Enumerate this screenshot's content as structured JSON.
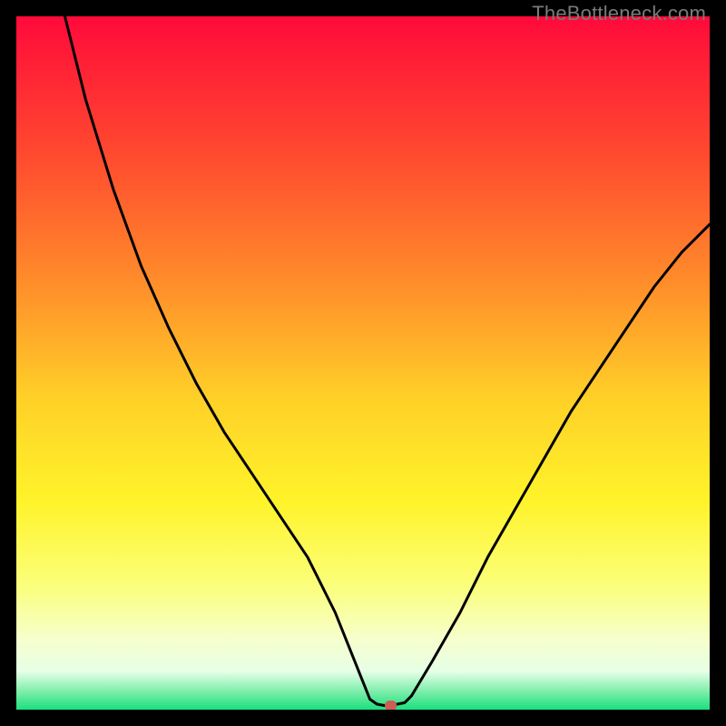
{
  "watermark": "TheBottleneck.com",
  "chart_data": {
    "type": "line",
    "title": "",
    "xlabel": "",
    "ylabel": "",
    "xlim": [
      0,
      100
    ],
    "ylim": [
      0,
      100
    ],
    "background_gradient": {
      "stops": [
        {
          "offset": 0.0,
          "color": "#ff0a3a"
        },
        {
          "offset": 0.2,
          "color": "#ff4a2f"
        },
        {
          "offset": 0.4,
          "color": "#ff932a"
        },
        {
          "offset": 0.55,
          "color": "#ffd028"
        },
        {
          "offset": 0.7,
          "color": "#fff32a"
        },
        {
          "offset": 0.82,
          "color": "#fbff7a"
        },
        {
          "offset": 0.9,
          "color": "#f6ffce"
        },
        {
          "offset": 0.945,
          "color": "#e6ffe6"
        },
        {
          "offset": 0.97,
          "color": "#8bf0b2"
        },
        {
          "offset": 1.0,
          "color": "#1be07d"
        }
      ]
    },
    "series": [
      {
        "name": "bottleneck-curve",
        "color": "#000000",
        "x": [
          7,
          10,
          14,
          18,
          22,
          26,
          30,
          34,
          38,
          42,
          46,
          48,
          50,
          51,
          52,
          53,
          54,
          56,
          57,
          60,
          64,
          68,
          72,
          76,
          80,
          84,
          88,
          92,
          96,
          100
        ],
        "y": [
          100,
          88,
          75,
          64,
          55,
          47,
          40,
          34,
          28,
          22,
          14,
          9,
          4,
          1.5,
          0.8,
          0.6,
          0.6,
          1.0,
          2,
          7,
          14,
          22,
          29,
          36,
          43,
          49,
          55,
          61,
          66,
          70
        ]
      }
    ],
    "marker": {
      "name": "optimal-point",
      "x": 54,
      "y": 0.6,
      "color": "#cc5d55",
      "rx": 6,
      "ry": 6
    }
  }
}
